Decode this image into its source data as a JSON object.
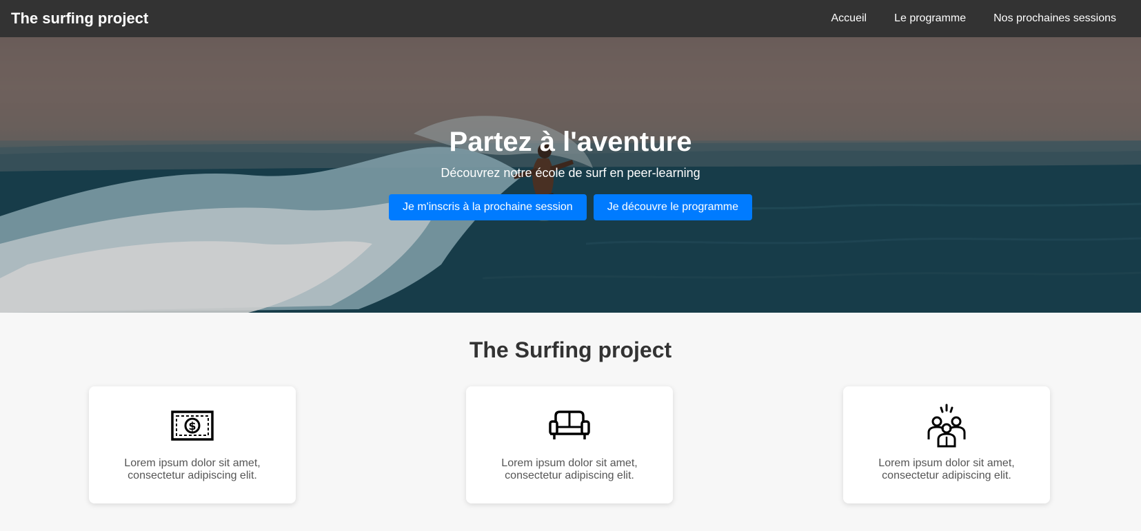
{
  "navbar": {
    "brand": "The surfing project",
    "links": [
      "Accueil",
      "Le programme",
      "Nos prochaines sessions"
    ]
  },
  "hero": {
    "title": "Partez à l'aventure",
    "subtitle": "Découvrez notre école de surf en peer-learning",
    "buttons": [
      "Je m'inscris à la prochaine session",
      "Je découvre le programme"
    ]
  },
  "features": {
    "title": "The Surfing project",
    "cards": [
      {
        "icon": "money-bill-icon",
        "text": "Lorem ipsum dolor sit amet, consectetur adipiscing elit."
      },
      {
        "icon": "sofa-icon",
        "text": "Lorem ipsum dolor sit amet, consectetur adipiscing elit."
      },
      {
        "icon": "group-people-icon",
        "text": "Lorem ipsum dolor sit amet, consectetur adipiscing elit."
      }
    ]
  },
  "colors": {
    "navbar": "#333333",
    "primary_button": "#007bff",
    "page_background": "#f7f7f7"
  }
}
